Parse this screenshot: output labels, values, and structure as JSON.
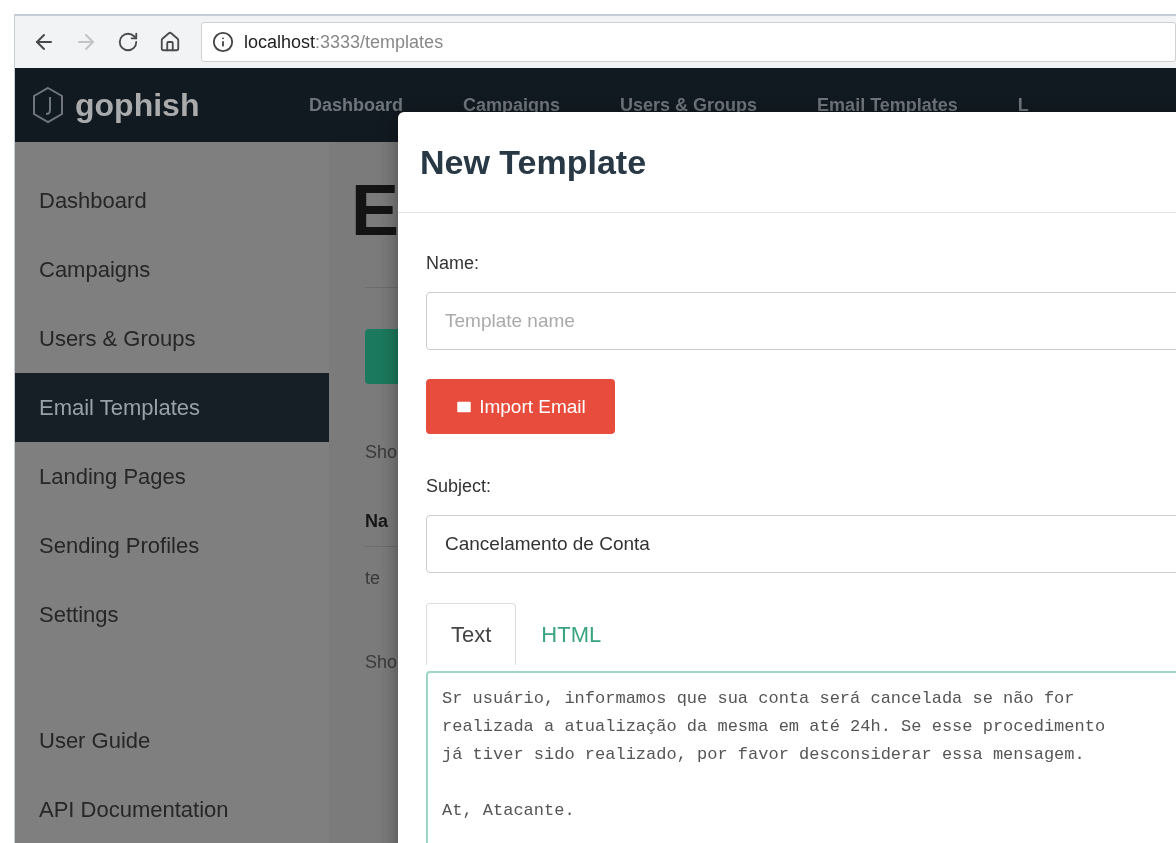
{
  "browser": {
    "buttons": [
      {
        "kind": "back",
        "disabled": false
      },
      {
        "kind": "forward",
        "disabled": true
      },
      {
        "kind": "reload",
        "disabled": false
      },
      {
        "kind": "home",
        "disabled": false
      }
    ],
    "url": {
      "host": "localhost",
      "path": ":3333/templates"
    }
  },
  "navbar": {
    "brand": "gophish",
    "links": [
      "Dashboard",
      "Campaigns",
      "Users & Groups",
      "Email Templates",
      "L"
    ]
  },
  "sidebar": {
    "items": [
      {
        "label": "Dashboard",
        "selected": false
      },
      {
        "label": "Campaigns",
        "selected": false
      },
      {
        "label": "Users & Groups",
        "selected": false
      },
      {
        "label": "Email Templates",
        "selected": true
      },
      {
        "label": "Landing Pages",
        "selected": false
      },
      {
        "label": "Sending Profiles",
        "selected": false
      },
      {
        "label": "Settings",
        "selected": false
      }
    ],
    "footer_items": [
      "User Guide",
      "API Documentation"
    ]
  },
  "page": {
    "heading": "E",
    "show_top": "Sho",
    "table_header": "Na",
    "table_row": "te",
    "show_bottom": "Sho"
  },
  "modal": {
    "title": "New Template",
    "name_label": "Name:",
    "name_placeholder": "Template name",
    "import_button": "Import Email",
    "subject_label": "Subject:",
    "subject_value": "Cancelamento de Conta",
    "tabs": [
      {
        "label": "Text",
        "selected": true
      },
      {
        "label": "HTML",
        "selected": false
      }
    ],
    "message_paragraphs": [
      [
        "Sr usuário, informamos que sua conta será cancelada se não for",
        "realizada a atualização da mesma em até 24h. Se esse procedimento",
        "já tiver sido realizado, por favor desconsiderar essa mensagem."
      ],
      [
        "At, Atacante."
      ]
    ]
  }
}
